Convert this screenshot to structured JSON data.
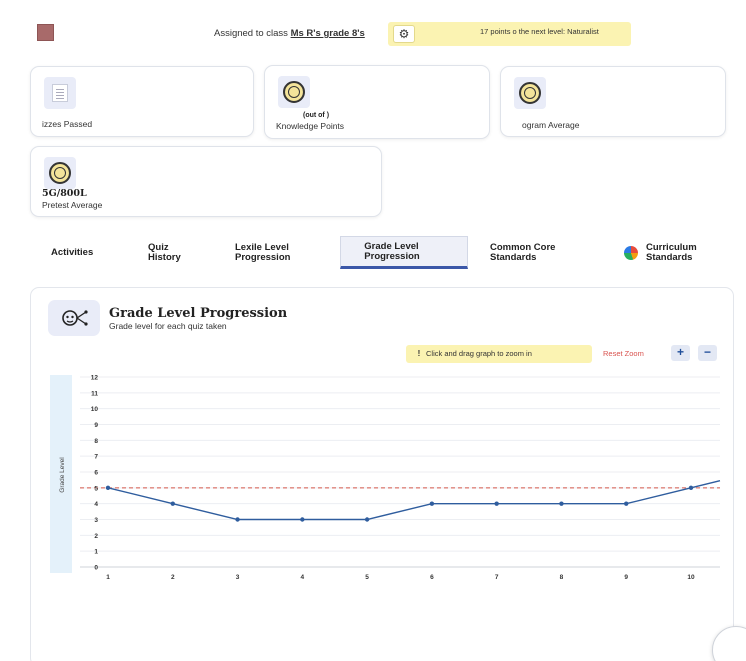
{
  "header": {
    "assigned_prefix": "Assigned to class",
    "class_name": "Ms R's grade 8's",
    "points_icon": "gear-icon",
    "points_text": "17 points  o the next level: Naturalist"
  },
  "stats": [
    {
      "icon": "document-icon",
      "value": "",
      "label": "izzes Passed"
    },
    {
      "icon": "medal-icon",
      "value": "(out of         )",
      "label": "Knowledge Points"
    },
    {
      "icon": "medal-icon",
      "value": "",
      "label": "ogram Average"
    },
    {
      "icon": "medal-icon",
      "value": "5G/800L",
      "label": "Pretest Average"
    }
  ],
  "tabs": [
    {
      "line1": "Activities",
      "line2": ""
    },
    {
      "line1": "Quiz",
      "line2": "History"
    },
    {
      "line1": "Lexile Level",
      "line2": "Progression"
    },
    {
      "line1": "Grade Level",
      "line2": "Progression"
    },
    {
      "line1": "Common Core",
      "line2": "Standards"
    },
    {
      "line1": "Curriculum",
      "line2": "Standards"
    }
  ],
  "panel": {
    "title": "Grade Level Progression",
    "subtitle": "Grade level for each quiz taken",
    "hint": "Click and drag graph to zoom in",
    "reset_zoom": "Reset Zoom",
    "zoom_in": "+",
    "zoom_out": "−"
  },
  "chart_data": {
    "type": "line",
    "ylabel": "Grade Level",
    "xlabel": "",
    "x": [
      1,
      2,
      3,
      4,
      5,
      6,
      7,
      8,
      9,
      10
    ],
    "series": [
      {
        "values": [
          5,
          4,
          3,
          3,
          3,
          4,
          4,
          4,
          4,
          5
        ],
        "color": "#2f5d9e"
      }
    ],
    "trailing_value": 5.5,
    "reference_line": {
      "value": 5,
      "color": "#d4574a",
      "style": "dashed"
    },
    "ylim": [
      0,
      12
    ],
    "yticks": [
      0,
      1,
      2,
      3,
      4,
      5,
      6,
      7,
      8,
      9,
      10,
      11,
      12
    ],
    "xticks": [
      1,
      2,
      3,
      4,
      5,
      6,
      7,
      8,
      9,
      10
    ],
    "grid": true
  }
}
